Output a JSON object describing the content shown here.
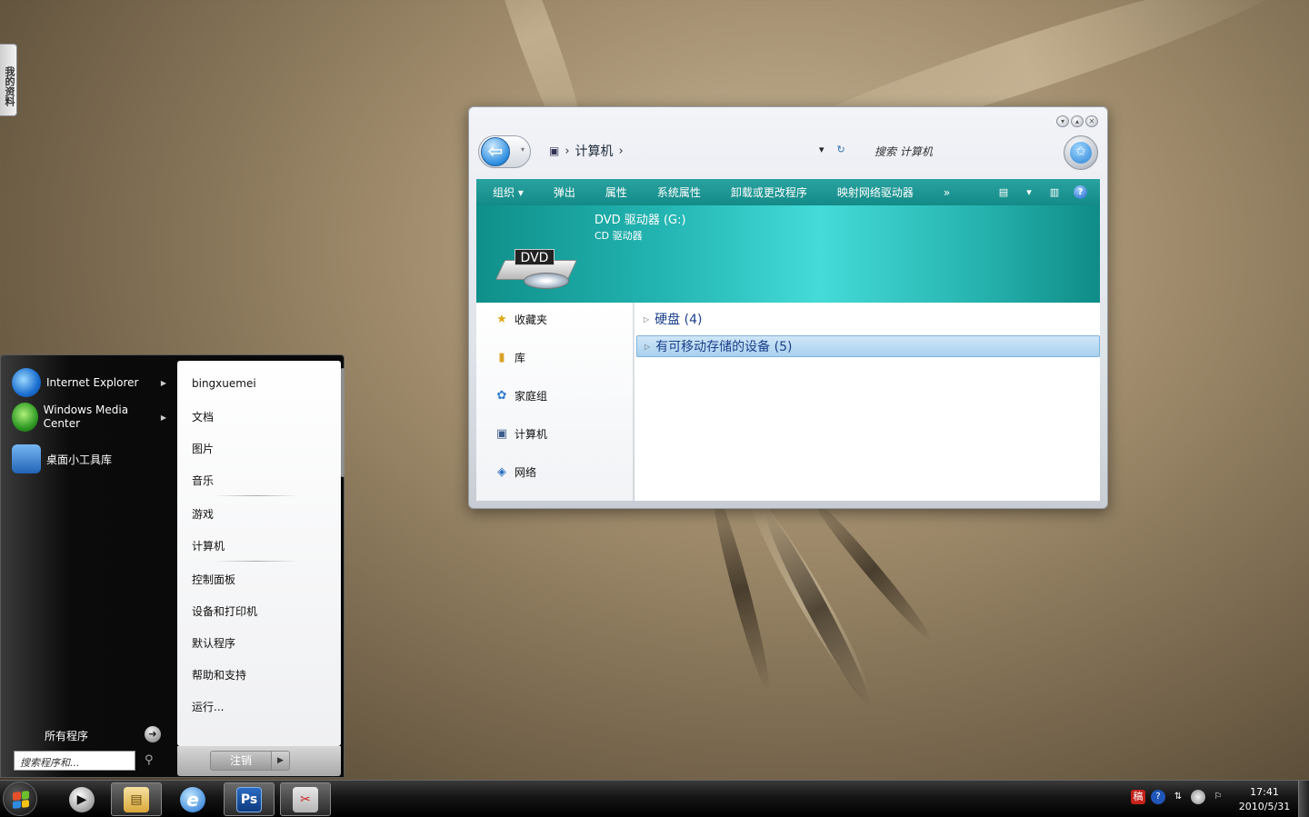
{
  "desktop": {
    "side_tab_label": "我的资料"
  },
  "explorer": {
    "window_controls": [
      "minimize",
      "maximize",
      "close"
    ],
    "breadcrumb": [
      "计算机"
    ],
    "search_placeholder": "搜索 计算机",
    "toolbar": {
      "items": [
        "组织 ▾",
        "弹出",
        "属性",
        "系统属性",
        "卸载或更改程序",
        "映射网络驱动器",
        "»"
      ]
    },
    "details": {
      "title": "DVD 驱动器 (G:)",
      "subtitle": "CD 驱动器",
      "icon_label": "DVD"
    },
    "nav": [
      "收藏夹",
      "库",
      "家庭组",
      "计算机",
      "网络"
    ],
    "groups": [
      {
        "label": "硬盘 (4)",
        "selected": false
      },
      {
        "label": "有可移动存储的设备 (5)",
        "selected": true
      }
    ]
  },
  "start_menu": {
    "programs": [
      {
        "label": "Internet Explorer",
        "icon": "ie-icon",
        "has_arrow": true
      },
      {
        "label": "Windows Media Center",
        "icon": "media-center-icon",
        "has_arrow": true
      },
      {
        "label": "桌面小工具库",
        "icon": "gadgets-icon",
        "has_arrow": false
      }
    ],
    "all_programs": "所有程序",
    "search_placeholder": "搜索程序和...",
    "places": [
      "bingxuemei",
      "文档",
      "图片",
      "音乐",
      "游戏",
      "计算机",
      "控制面板",
      "设备和打印机",
      "默认程序",
      "帮助和支持",
      "运行..."
    ],
    "shutdown_label": "注销"
  },
  "taskbar": {
    "apps": [
      {
        "name": "media-player",
        "glyph": "▶"
      },
      {
        "name": "explorer",
        "glyph": "▤"
      },
      {
        "name": "internet-explorer",
        "glyph": "e"
      },
      {
        "name": "photoshop",
        "glyph": "Ps"
      },
      {
        "name": "tool",
        "glyph": "✂"
      }
    ],
    "tray_ime": "稿",
    "clock_time": "17:41",
    "clock_date": "2010/5/31"
  }
}
